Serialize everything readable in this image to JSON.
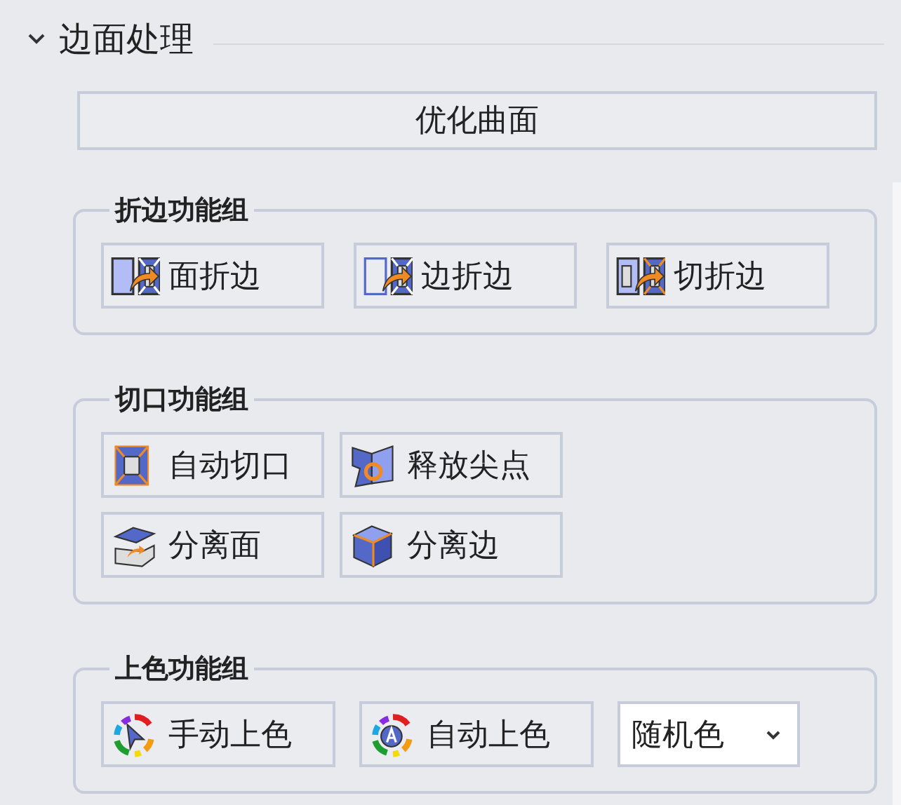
{
  "section": {
    "title": "边面处理",
    "expanded": true
  },
  "optimize_button": "优化曲面",
  "groups": [
    {
      "title": "折边功能组",
      "rows": [
        [
          "面折边",
          "边折边",
          "切折边"
        ]
      ]
    },
    {
      "title": "切口功能组",
      "rows": [
        [
          "自动切口",
          "释放尖点"
        ],
        [
          "分离面",
          "分离边"
        ]
      ]
    },
    {
      "title": "上色功能组",
      "rows": [
        [
          "手动上色",
          "自动上色"
        ]
      ],
      "select": {
        "value": "随机色"
      }
    }
  ]
}
